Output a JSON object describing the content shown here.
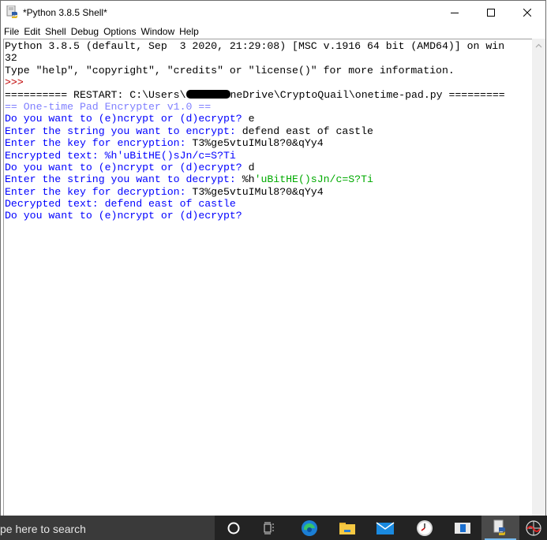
{
  "window": {
    "title": "*Python 3.8.5 Shell*",
    "controls": {
      "minimize": "minimize",
      "maximize": "maximize",
      "close": "close"
    }
  },
  "menubar": {
    "items": [
      "File",
      "Edit",
      "Shell",
      "Debug",
      "Options",
      "Window",
      "Help"
    ]
  },
  "shell": {
    "lines": [
      {
        "segments": [
          {
            "text": "Python 3.8.5 (default, Sep  3 2020, 21:29:08) [MSC v.1916 64 bit (AMD64)] on win",
            "color": "black"
          }
        ]
      },
      {
        "segments": [
          {
            "text": "32",
            "color": "black"
          }
        ]
      },
      {
        "segments": [
          {
            "text": "Type \"help\", \"copyright\", \"credits\" or \"license()\" for more information.",
            "color": "black"
          }
        ]
      },
      {
        "segments": [
          {
            "text": ">>> ",
            "color": "prompt"
          }
        ]
      },
      {
        "segments": [
          {
            "text": "========== RESTART: C:\\Users\\",
            "color": "black"
          },
          {
            "redacted": true
          },
          {
            "text": "neDrive\\CryptoQuail\\onetime-pad.py =========",
            "color": "black"
          }
        ]
      },
      {
        "segments": [
          {
            "text": "== One-time Pad Encrypter v1.0 ==",
            "color": "banner"
          }
        ]
      },
      {
        "segments": [
          {
            "text": "Do you want to (e)ncrypt or (d)ecrypt? ",
            "color": "blue"
          },
          {
            "text": "e",
            "color": "black"
          }
        ]
      },
      {
        "segments": [
          {
            "text": "Enter the string you want to encrypt: ",
            "color": "blue"
          },
          {
            "text": "defend east of castle",
            "color": "black"
          }
        ]
      },
      {
        "segments": [
          {
            "text": "Enter the key for encryption: ",
            "color": "blue"
          },
          {
            "text": "T3%ge5vtuIMul8?0&qYy4",
            "color": "black"
          }
        ]
      },
      {
        "segments": [
          {
            "text": "Encrypted text: %h'uBitHE()sJn/c=S?Ti",
            "color": "blue"
          }
        ]
      },
      {
        "segments": [
          {
            "text": "Do you want to (e)ncrypt or (d)ecrypt? ",
            "color": "blue"
          },
          {
            "text": "d",
            "color": "black"
          }
        ]
      },
      {
        "segments": [
          {
            "text": "Enter the string you want to decrypt: ",
            "color": "blue"
          },
          {
            "text": "%h",
            "color": "black"
          },
          {
            "text": "'uBitHE()sJn/c=S?Ti",
            "color": "green"
          }
        ]
      },
      {
        "segments": [
          {
            "text": "Enter the key for decryption: ",
            "color": "blue"
          },
          {
            "text": "T3%ge5vtuIMul8?0&qYy4",
            "color": "black"
          }
        ]
      },
      {
        "segments": [
          {
            "text": "Decrypted text: defend east of castle",
            "color": "blue"
          }
        ]
      },
      {
        "segments": [
          {
            "text": "Do you want to (e)ncrypt or (d)ecrypt? ",
            "color": "blue"
          }
        ]
      }
    ]
  },
  "taskbar": {
    "search_placeholder": "pe here to search",
    "icons": [
      {
        "name": "cortana-icon"
      },
      {
        "name": "task-view-icon"
      },
      {
        "name": "edge-icon"
      },
      {
        "name": "file-explorer-icon"
      },
      {
        "name": "mail-icon"
      },
      {
        "name": "alarms-clock-icon"
      },
      {
        "name": "app-window-icon"
      },
      {
        "name": "python-idle-icon",
        "active": true
      },
      {
        "name": "network-web-icon"
      }
    ]
  },
  "colors": {
    "black": "#000000",
    "blue": "#0000ff",
    "prompt": "#c00000",
    "green": "#00aa00",
    "banner": "#7f7fff",
    "taskbar_bg": "#232323"
  }
}
